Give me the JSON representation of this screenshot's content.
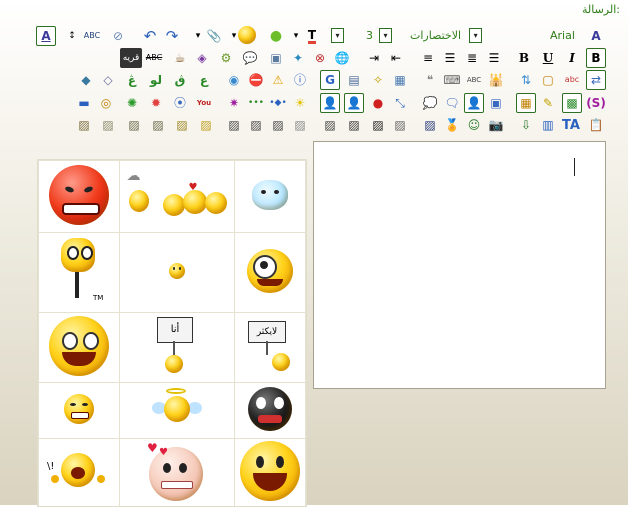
{
  "header": {
    "message_label": "الرسالة:"
  },
  "toolbar": {
    "font_name": "Arial",
    "shortcuts_label": "الاختصارات",
    "font_size": "3",
    "bold_label": "B",
    "underline_label": "U",
    "italic_label": "I",
    "spell_label": "ABC",
    "abc_label": "ABC",
    "font_color_label": "A",
    "highlight_label": "A",
    "ta_label": "TA",
    "clip_label": "ﻗﺮﻳﻪ"
  },
  "colors": {
    "accent_green": "#2e7d17",
    "frame_green": "#2f6f24",
    "background_light": "#f7f5ee",
    "background_dark": "#d9d3bf"
  },
  "emoticons": {
    "sign_ana": "أنا",
    "sign_like": "لايكثر",
    "tm": "TM"
  },
  "editor": {
    "content": ""
  }
}
